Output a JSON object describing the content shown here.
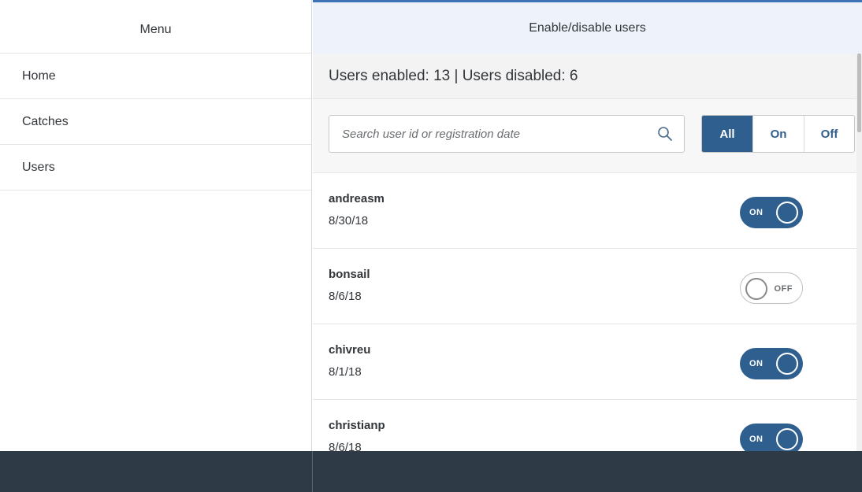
{
  "menu": {
    "title": "Menu",
    "items": [
      {
        "label": "Home"
      },
      {
        "label": "Catches"
      },
      {
        "label": "Users"
      }
    ]
  },
  "detail": {
    "title": "Enable/disable users",
    "stats": "Users enabled: 13 | Users disabled: 6",
    "search": {
      "placeholder": "Search user id or registration date",
      "icon": "search-icon"
    },
    "filter": {
      "options": [
        "All",
        "On",
        "Off"
      ],
      "selected": "All"
    },
    "users": [
      {
        "id": "andreasm",
        "date": "8/30/18",
        "state": "ON"
      },
      {
        "id": "bonsail",
        "date": "8/6/18",
        "state": "OFF"
      },
      {
        "id": "chivreu",
        "date": "8/1/18",
        "state": "ON"
      },
      {
        "id": "christianp",
        "date": "8/6/18",
        "state": "ON"
      }
    ]
  },
  "colors": {
    "accent": "#2f5f8e",
    "header_bg": "#eef3fb",
    "footer_bg": "#2e3a46"
  }
}
